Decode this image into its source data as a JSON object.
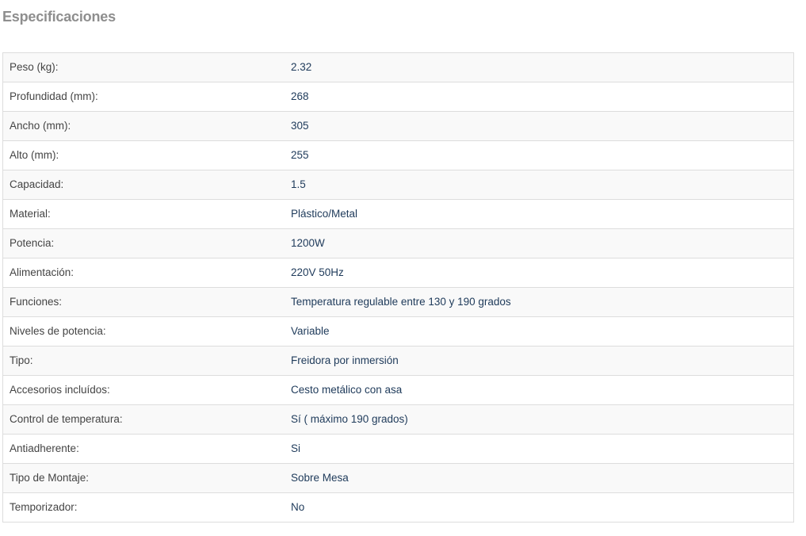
{
  "section": {
    "title": "Especificaciones"
  },
  "specs": [
    {
      "label": "Peso (kg):",
      "value": "2.32"
    },
    {
      "label": "Profundidad (mm):",
      "value": "268"
    },
    {
      "label": "Ancho (mm):",
      "value": "305"
    },
    {
      "label": "Alto (mm):",
      "value": "255"
    },
    {
      "label": "Capacidad:",
      "value": "1.5"
    },
    {
      "label": "Material:",
      "value": "Plástico/Metal"
    },
    {
      "label": "Potencia:",
      "value": "1200W"
    },
    {
      "label": "Alimentación:",
      "value": "220V 50Hz"
    },
    {
      "label": "Funciones:",
      "value": "Temperatura regulable entre 130 y 190 grados"
    },
    {
      "label": "Niveles de potencia:",
      "value": "Variable"
    },
    {
      "label": "Tipo:",
      "value": "Freidora por inmersión"
    },
    {
      "label": "Accesorios incluídos:",
      "value": "Cesto metálico con asa"
    },
    {
      "label": "Control de temperatura:",
      "value": "Sí ( máximo 190 grados)"
    },
    {
      "label": "Antiadherente:",
      "value": "Si"
    },
    {
      "label": "Tipo de Montaje:",
      "value": "Sobre Mesa"
    },
    {
      "label": "Temporizador:",
      "value": "No"
    }
  ],
  "colors": {
    "title": "#8e8e8e",
    "label_text": "#444444",
    "value_text": "#1e3a5a",
    "row_odd": "#f9f9f9",
    "row_even": "#ffffff",
    "border": "#dddddd"
  }
}
